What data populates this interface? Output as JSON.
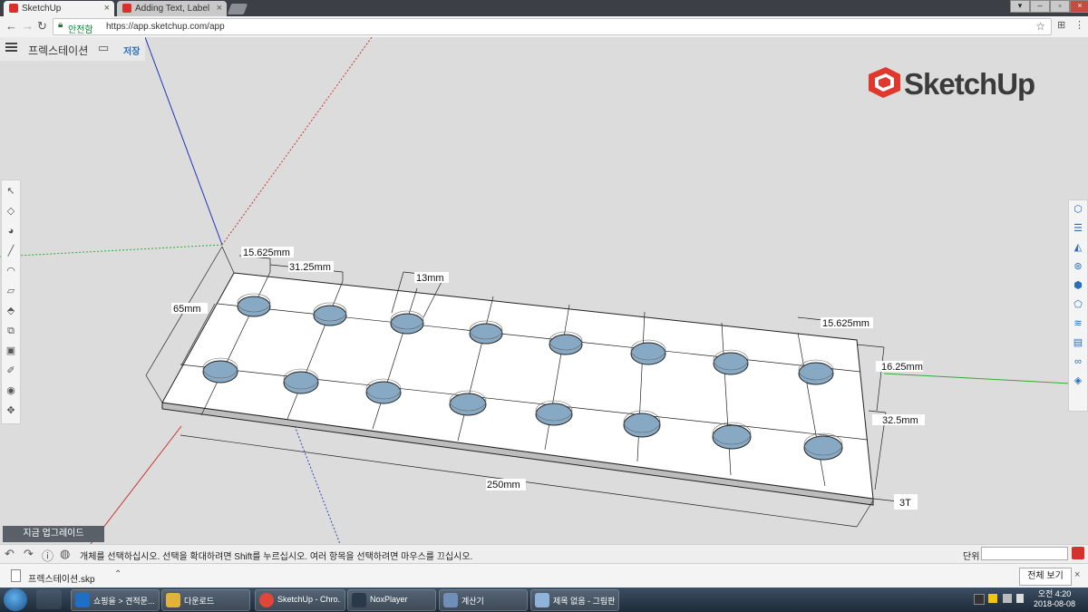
{
  "browser": {
    "tabs": [
      {
        "label": "SketchUp",
        "icon": "sketchup-icon"
      },
      {
        "label": "Adding Text, Labels, and",
        "icon": "sketchup-icon"
      }
    ],
    "secure_label": "안전함",
    "url": "https://app.sketchup.com/app"
  },
  "app": {
    "document_name": "프렉스테이션",
    "save_label": "저장",
    "logo_text": "SketchUp",
    "upgrade_label": "지금 업그레이드",
    "status_text": "개체를 선택하십시오. 선택을 확대하려면 Shift를 누르십시오. 여러 항목을 선택하려면 마우스를 끄십시오.",
    "unit_label": "단위",
    "unit_value": ""
  },
  "model": {
    "dimensions": {
      "left_gap": "15.625mm",
      "column_pitch": "31.25mm",
      "hole_diameter": "13mm",
      "depth": "65mm",
      "right_gap": "15.625mm",
      "row_gap": "16.25mm",
      "row_pitch": "32.5mm",
      "length": "250mm",
      "thickness": "3T"
    },
    "colors": {
      "plate": "#ffffff",
      "hole": "#87a9c4",
      "edge": "#222222"
    }
  },
  "downloads": {
    "file_name": "프렉스테이션.skp",
    "show_all_label": "전체 보기"
  },
  "taskbar": {
    "items": [
      {
        "label": "쇼핑을 > 견적문...",
        "color": "#1f6fc6"
      },
      {
        "label": "다운로드",
        "color": "#e3b23c"
      },
      {
        "label": "SketchUp - Chro...",
        "color": "#e0463a"
      },
      {
        "label": "NoxPlayer",
        "color": "#2b3a4a"
      },
      {
        "label": "계산기",
        "color": "#6f8fb8"
      },
      {
        "label": "제목 없음 - 그림판",
        "color": "#8fb3d9"
      }
    ],
    "time": "오전 4:20",
    "date": "2018-08-08"
  }
}
